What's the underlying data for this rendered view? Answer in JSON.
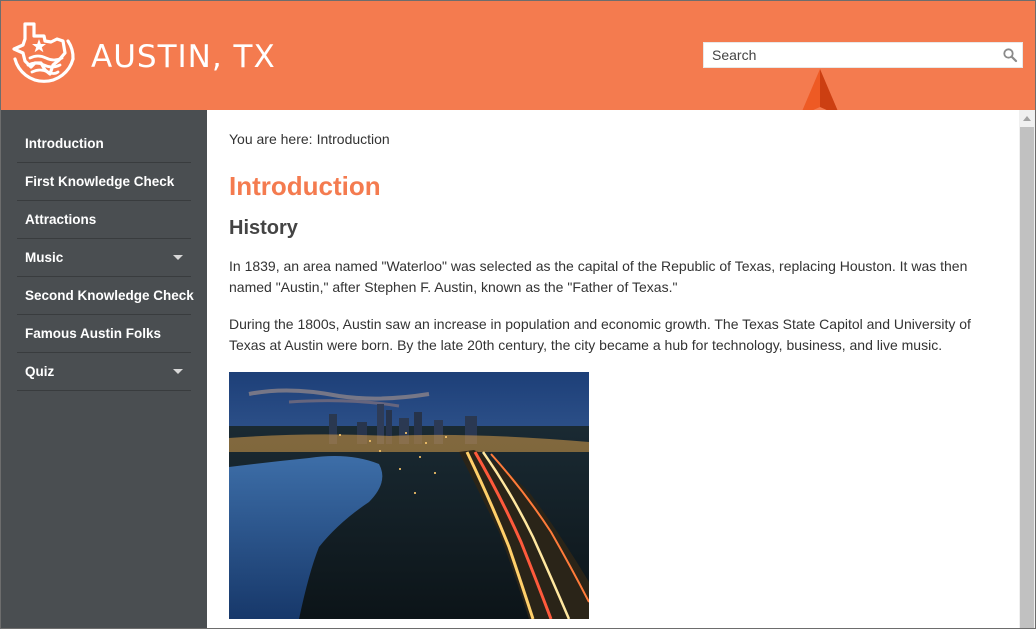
{
  "app": {
    "title": "AUSTIN, TX"
  },
  "colors": {
    "brand": "#f47b4f",
    "sidebar": "#4a4e51",
    "heading": "#f47b4f",
    "pointer": "#ee5a24"
  },
  "search": {
    "placeholder": "Search",
    "icon": "magnifier-icon"
  },
  "sidebar": {
    "items": [
      {
        "label": "Introduction",
        "has_submenu": false,
        "active": true
      },
      {
        "label": "First Knowledge Check",
        "has_submenu": false
      },
      {
        "label": "Attractions",
        "has_submenu": false
      },
      {
        "label": "Music",
        "has_submenu": true
      },
      {
        "label": "Second Knowledge Check",
        "has_submenu": false
      },
      {
        "label": "Famous Austin Folks",
        "has_submenu": false
      },
      {
        "label": "Quiz",
        "has_submenu": true
      }
    ]
  },
  "breadcrumb": {
    "prefix": "You are here:",
    "current": "Introduction"
  },
  "main": {
    "title": "Introduction",
    "section_title": "History",
    "paragraphs": [
      "In 1839, an area named \"Waterloo\" was selected as the capital of the Republic of Texas, replacing Houston. It was then named \"Austin,\" after Stephen F. Austin, known as the \"Father of Texas.\"",
      "During the 1800s, Austin saw an increase in population and economic growth. The Texas State Capitol and University of Texas at Austin were born. By the late 20th century, the city became a hub for technology, business, and live music."
    ]
  }
}
